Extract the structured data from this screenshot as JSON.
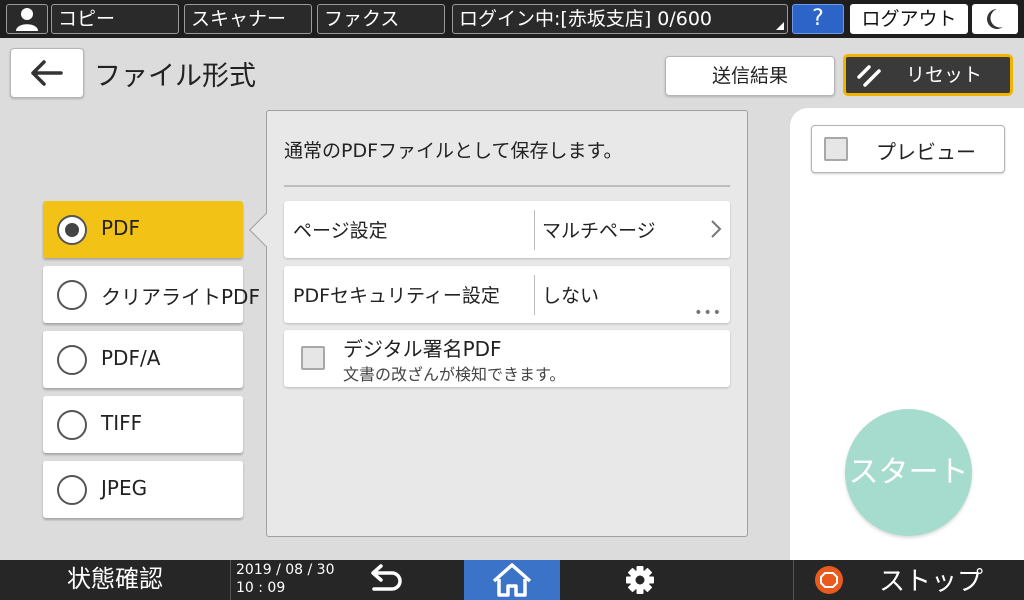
{
  "topbar": {
    "copy": "コピー",
    "scanner": "スキャナー",
    "fax": "ファクス",
    "login_status": "ログイン中:[赤坂支店] 0/600",
    "help": "?",
    "logout": "ログアウト"
  },
  "header": {
    "title": "ファイル形式",
    "send_result": "送信結果",
    "reset": "リセット"
  },
  "formats": [
    {
      "label": "PDF",
      "selected": true
    },
    {
      "label": "クリアライトPDF",
      "selected": false
    },
    {
      "label": "PDF/A",
      "selected": false
    },
    {
      "label": "TIFF",
      "selected": false
    },
    {
      "label": "JPEG",
      "selected": false
    }
  ],
  "panel": {
    "description": "通常のPDFファイルとして保存します。",
    "settings": [
      {
        "name": "ページ設定",
        "value": "マルチページ"
      },
      {
        "name": "PDFセキュリティー設定",
        "value": "しない"
      }
    ],
    "signature": {
      "title": "デジタル署名PDF",
      "subtitle": "文書の改ざんが検知できます。"
    }
  },
  "right": {
    "preview": "プレビュー",
    "start": "スタート"
  },
  "bottombar": {
    "status": "状態確認",
    "date": "2019 / 08 / 30",
    "time": "10 : 09",
    "stop": "ストップ"
  },
  "colors": {
    "selected": "#f2c316",
    "home": "#3a73c8",
    "start": "#a6dccd",
    "stop": "#e85a1e",
    "help": "#2c64c8",
    "reset_border": "#f0b400"
  },
  "icons": [
    "user-icon",
    "moon-icon",
    "back-arrow-icon",
    "reset-icon",
    "chevron-right-icon",
    "undo-icon",
    "home-icon",
    "gear-icon",
    "stop-icon"
  ]
}
